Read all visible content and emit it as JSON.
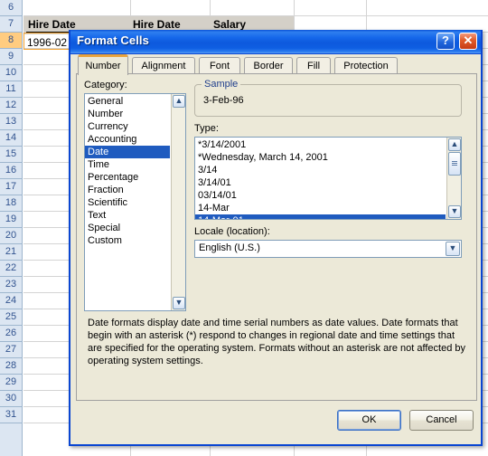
{
  "spreadsheet": {
    "row_headers": [
      "6",
      "7",
      "8",
      "9",
      "10",
      "11",
      "12",
      "13",
      "14",
      "15",
      "16",
      "17",
      "18",
      "19",
      "20",
      "21",
      "22",
      "23",
      "24",
      "25",
      "26",
      "27",
      "28",
      "29",
      "30",
      "31"
    ],
    "active_row": "8",
    "headers": [
      "Hire Date",
      "Hire Date",
      "Salary"
    ],
    "cells": {
      "row8_col1": "1996-02"
    }
  },
  "dialog": {
    "title": "Format Cells",
    "help_button": "?",
    "close_button": "✕",
    "tabs": [
      {
        "label": "Number",
        "active": true
      },
      {
        "label": "Alignment",
        "active": false
      },
      {
        "label": "Font",
        "active": false
      },
      {
        "label": "Border",
        "active": false
      },
      {
        "label": "Fill",
        "active": false
      },
      {
        "label": "Protection",
        "active": false
      }
    ],
    "category": {
      "label": "Category:",
      "items": [
        "General",
        "Number",
        "Currency",
        "Accounting",
        "Date",
        "Time",
        "Percentage",
        "Fraction",
        "Scientific",
        "Text",
        "Special",
        "Custom"
      ],
      "selected": "Date"
    },
    "sample": {
      "label": "Sample",
      "value": "3-Feb-96"
    },
    "type": {
      "label": "Type:",
      "items": [
        "*3/14/2001",
        "*Wednesday, March 14, 2001",
        "3/14",
        "3/14/01",
        "03/14/01",
        "14-Mar",
        "14-Mar-01"
      ],
      "selected": "14-Mar-01"
    },
    "locale": {
      "label": "Locale (location):",
      "value": "English (U.S.)"
    },
    "description": "Date formats display date and time serial numbers as date values.  Date formats that begin with an asterisk (*) respond to changes in regional date and time settings that are specified for the operating system. Formats without an asterisk are not affected by operating system settings.",
    "buttons": {
      "ok": "OK",
      "cancel": "Cancel"
    }
  },
  "colors": {
    "titlebar_blue": "#1668ea",
    "selection_blue": "#1f5bbf",
    "active_tab_accent": "#e8a33d",
    "dialog_face": "#ece9d8",
    "row_header_blue": "#dce6f2",
    "active_row_orange": "#ffcc80"
  }
}
